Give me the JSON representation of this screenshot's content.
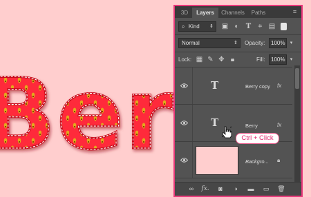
{
  "canvas": {
    "artwork_text": "Berry",
    "background_color": "#ffcece",
    "text_color": "#ff2a3b",
    "stitch_color": "#ffffff",
    "seed_color": "#d9a21a"
  },
  "panel": {
    "tabs": [
      {
        "label": "3D"
      },
      {
        "label": "Layers"
      },
      {
        "label": "Channels"
      },
      {
        "label": "Paths"
      }
    ],
    "active_tab": "Layers",
    "filter": {
      "kind_label": "Kind"
    },
    "blend_mode": "Normal",
    "opacity_label": "Opacity:",
    "opacity_value": "100%",
    "lock_label": "Lock:",
    "fill_label": "Fill:",
    "fill_value": "100%",
    "layers": [
      {
        "name": "Berry copy",
        "type": "text",
        "has_fx": true,
        "fx_label": "fx"
      },
      {
        "name": "Berry",
        "type": "text",
        "has_fx": true,
        "fx_label": "fx"
      },
      {
        "name": "Backgro...",
        "type": "background",
        "thumb_color": "#ffcece",
        "locked": true
      }
    ],
    "text_glyph": "T",
    "bottom_fx_label": "fx."
  },
  "tooltip": {
    "text": "Ctrl + Click"
  },
  "accent": "#e8387a"
}
